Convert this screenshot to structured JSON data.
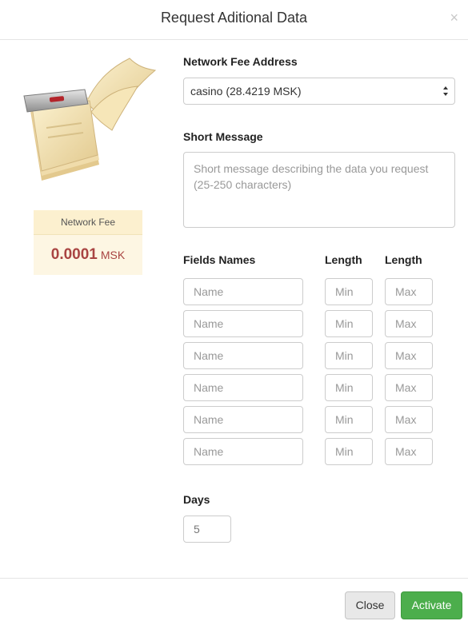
{
  "modal": {
    "title": "Request Aditional Data",
    "close_glyph": "×"
  },
  "fee": {
    "label": "Network Fee",
    "value": "0.0001",
    "unit": "MSK"
  },
  "network_fee_address": {
    "label": "Network Fee Address",
    "selected": "casino (28.4219 MSK)"
  },
  "short_message": {
    "label": "Short Message",
    "placeholder": "Short message describing the data you request (25-250 characters)"
  },
  "fields": {
    "header_names": "Fields Names",
    "header_length_min": "Length",
    "header_length_max": "Length",
    "rows": [
      {
        "name": "Name",
        "min": "Min",
        "max": "Max"
      },
      {
        "name": "Name",
        "min": "Min",
        "max": "Max"
      },
      {
        "name": "Name",
        "min": "Min",
        "max": "Max"
      },
      {
        "name": "Name",
        "min": "Min",
        "max": "Max"
      },
      {
        "name": "Name",
        "min": "Min",
        "max": "Max"
      },
      {
        "name": "Name",
        "min": "Min",
        "max": "Max"
      }
    ]
  },
  "days": {
    "label": "Days",
    "value": "5"
  },
  "footer": {
    "close_label": "Close",
    "activate_label": "Activate"
  },
  "icons": {
    "close": "close-icon",
    "illustration": "tear-off-calendar-icon",
    "select_arrows": "select-arrows-icon"
  },
  "colors": {
    "activate": "#4cae4c",
    "fee_value": "#a94442",
    "fee_box": "#fdf6e3"
  }
}
